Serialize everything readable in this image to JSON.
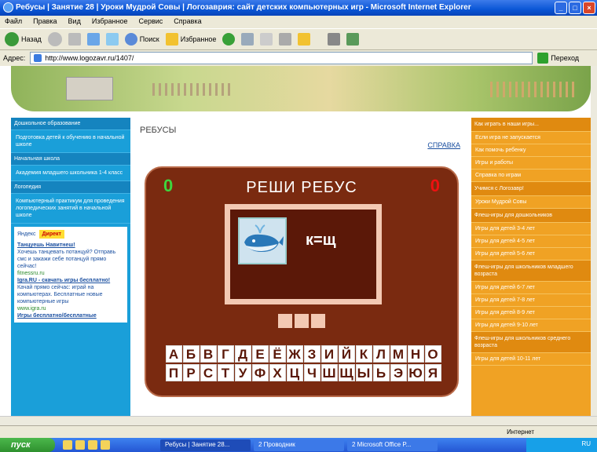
{
  "window": {
    "title": "Ребусы | Занятие 28 | Уроки Мудрой Совы | Логозаврия: сайт детских компьютерных игр - Microsoft Internet Explorer"
  },
  "menu": [
    "Файл",
    "Правка",
    "Вид",
    "Избранное",
    "Сервис",
    "Справка"
  ],
  "toolbar": {
    "back": "Назад",
    "search": "Поиск",
    "favorites": "Избранное"
  },
  "address": {
    "label": "Адрес:",
    "url": "http://www.logozavr.ru/1407/",
    "go": "Переход"
  },
  "left": {
    "sec1": "Дошкольное образование",
    "link1": "Подготовка детей к обучению в начальной школе",
    "sec2": "Начальная школа",
    "link2": "Академия младшего школьника 1-4 класс",
    "sec3": "Логопедия",
    "link3": "Компьютерный практикум для проведения логопедических занятий в начальной школе",
    "ad": {
      "yandex_label": "Яндекс",
      "direct": "Директ",
      "t1": "Танцуешь Навитнеш!",
      "d1": "Хочешь танцевать потанцуй? Отправь смс и закажи себе потанцуй прямо сейчас!",
      "u1": "fitnessru.ru",
      "t2": "Igra.RU - скачать игры бесплатно!",
      "d2": "Качай прямо сейчас: играй на компьютерах. Бесплатные новые компьютерные игры",
      "u2": "www.igra.ru",
      "t3": "Игры бесплатно/бесплатные"
    }
  },
  "main": {
    "heading": "РЕБУСЫ",
    "help": "СПРАВКА",
    "score_left": "0",
    "score_right": "0",
    "game_title": "РЕШИ  РЕБУС",
    "formula": "к=щ",
    "row1": [
      "А",
      "Б",
      "В",
      "Г",
      "Д",
      "Е",
      "Ё",
      "Ж",
      "З",
      "И",
      "Й",
      "К",
      "Л",
      "М",
      "Н",
      "О"
    ],
    "row2": [
      "П",
      "Р",
      "С",
      "Т",
      "У",
      "Ф",
      "Х",
      "Ц",
      "Ч",
      "Ш",
      "Щ",
      "Ы",
      "Ь",
      "Э",
      "Ю",
      "Я"
    ]
  },
  "right": {
    "sec1": "Как играть в наши игры...",
    "links1": [
      "Если игра не запускается",
      "Как помочь ребенку",
      "Игры и работы",
      "Справка по играм"
    ],
    "sec2": "Учимся с Логозавр!",
    "links2": [
      "Уроки Мудрой Совы"
    ],
    "sec3": "Флеш-игры для дошкольников",
    "links3": [
      "Игры для детей 3-4 лет",
      "Игры для детей 4-5 лет",
      "Игры для детей 5-6 лет"
    ],
    "sec4": "Флеш-игры для школьников младшего возраста",
    "links4": [
      "Игры для детей 6-7 лет",
      "Игры для детей 7-8 лет",
      "Игры для детей 8-9 лет",
      "Игры для детей 9-10 лет"
    ],
    "sec5": "Флеш-игры для школьников среднего возраста",
    "links5": [
      "Игры для детей 10-11 лет"
    ]
  },
  "status": {
    "zone": "Интернет"
  },
  "taskbar": {
    "start": "пуск",
    "tasks": [
      "Ребусы | Занятие 28...",
      "2 Проводник",
      "2 Microsoft Office P..."
    ],
    "tray": "RU"
  },
  "colors": {
    "left_panel": "#1a9fd9",
    "right_panel": "#f0a224",
    "game_bg": "#7a2a10",
    "score_left": "#3ed63e",
    "score_right": "#e11"
  }
}
